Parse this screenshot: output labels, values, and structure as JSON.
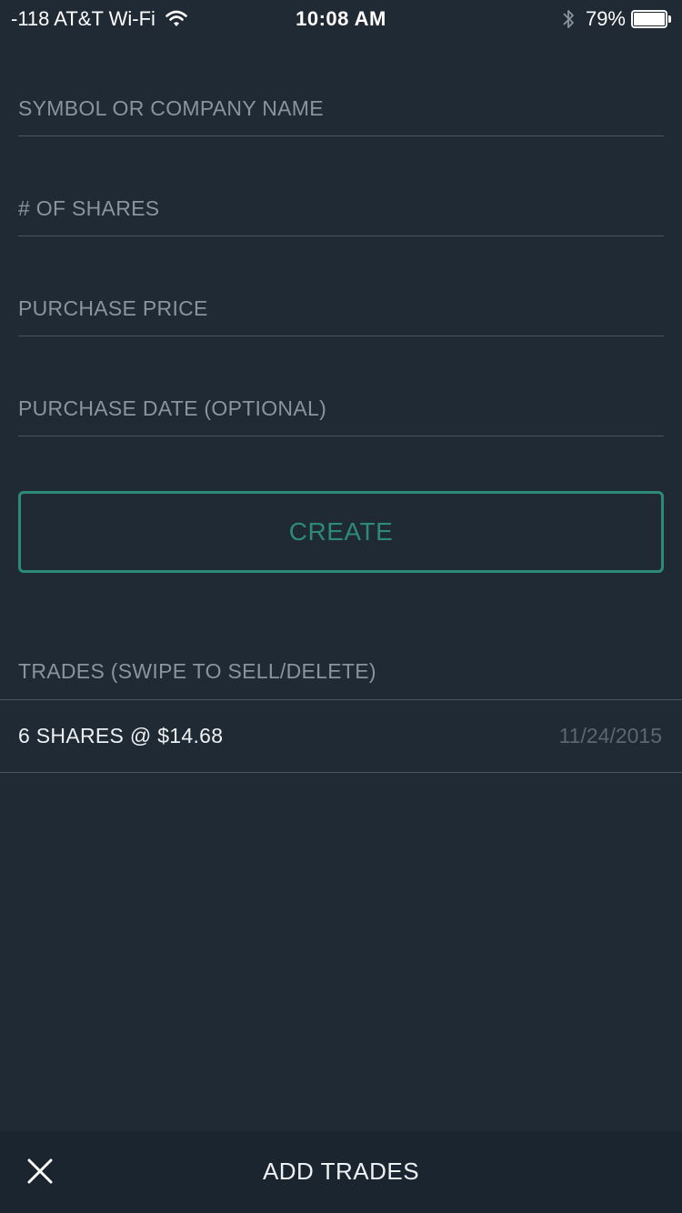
{
  "status_bar": {
    "carrier": "-118 AT&T Wi-Fi",
    "time": "10:08 AM",
    "battery": "79%",
    "icons": [
      "wifi-icon",
      "bluetooth-icon",
      "battery-icon"
    ]
  },
  "form": {
    "symbol": {
      "placeholder": "SYMBOL OR COMPANY NAME",
      "value": ""
    },
    "shares": {
      "placeholder": "# OF SHARES",
      "value": ""
    },
    "price": {
      "placeholder": "PURCHASE PRICE",
      "value": ""
    },
    "date": {
      "placeholder": "PURCHASE DATE (OPTIONAL)",
      "value": ""
    },
    "create_label": "CREATE"
  },
  "trades": {
    "header": "TRADES (SWIPE TO SELL/DELETE)",
    "items": [
      {
        "description": "6 SHARES @ $14.68",
        "date": "11/24/2015"
      }
    ]
  },
  "bottom_bar": {
    "title": "ADD TRADES",
    "close_icon": "close-icon"
  },
  "colors": {
    "background": "#1f2a35",
    "accent": "#2e8a78",
    "divider": "#4a5561",
    "bottom_bar": "#1b252f"
  }
}
